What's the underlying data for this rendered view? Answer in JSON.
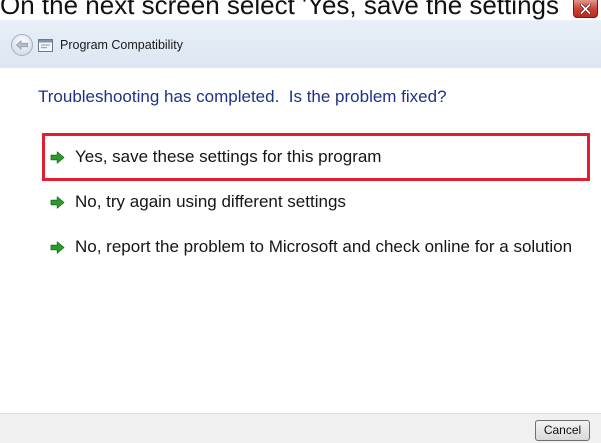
{
  "caption": "On the next screen select 'Yes, save the settings",
  "window": {
    "title": "Program Compatibility",
    "back_icon": "back-arrow-icon",
    "app_icon": "program-compatibility-icon",
    "close_icon": "close-icon"
  },
  "main": {
    "heading": "Troubleshooting has completed.  Is the problem fixed?",
    "options": [
      {
        "label": "Yes, save these settings for this program",
        "icon": "green-arrow-icon",
        "highlighted": true
      },
      {
        "label": "No, try again using different settings",
        "icon": "green-arrow-icon",
        "highlighted": false
      },
      {
        "label": "No, report the problem to Microsoft and check online for a solution",
        "icon": "green-arrow-icon",
        "highlighted": false
      }
    ]
  },
  "footer": {
    "cancel_label": "Cancel"
  },
  "colors": {
    "heading": "#1e3287",
    "arrow": "#2c9b2c",
    "highlight": "#e0202e",
    "close_button": "#cf4436",
    "footer_bg": "#f0f0f0"
  }
}
